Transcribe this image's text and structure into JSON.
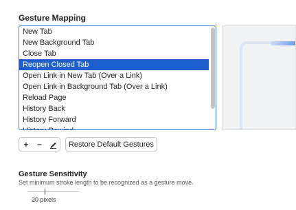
{
  "gesture_mapping": {
    "title": "Gesture Mapping",
    "actions": [
      {
        "label": "New Tab",
        "selected": false
      },
      {
        "label": "New Background Tab",
        "selected": false
      },
      {
        "label": "Close Tab",
        "selected": false
      },
      {
        "label": "Reopen Closed Tab",
        "selected": true
      },
      {
        "label": "Open Link in New Tab (Over a Link)",
        "selected": false
      },
      {
        "label": "Open Link in Background Tab (Over a Link)",
        "selected": false
      },
      {
        "label": "Reload Page",
        "selected": false
      },
      {
        "label": "History Back",
        "selected": false
      },
      {
        "label": "History Forward",
        "selected": false
      },
      {
        "label": "History Rewind",
        "selected": false
      }
    ],
    "accent_color": "#1d5fcf"
  },
  "toolbar": {
    "add_label": "+",
    "remove_label": "−",
    "edit_icon": "pencil-icon",
    "restore_label": "Restore Default Gestures"
  },
  "sensitivity": {
    "title": "Gesture Sensitivity",
    "description": "Set minimum stroke length to be recognized as a gesture move.",
    "value_label": "20 pixels",
    "level": 0.33
  }
}
